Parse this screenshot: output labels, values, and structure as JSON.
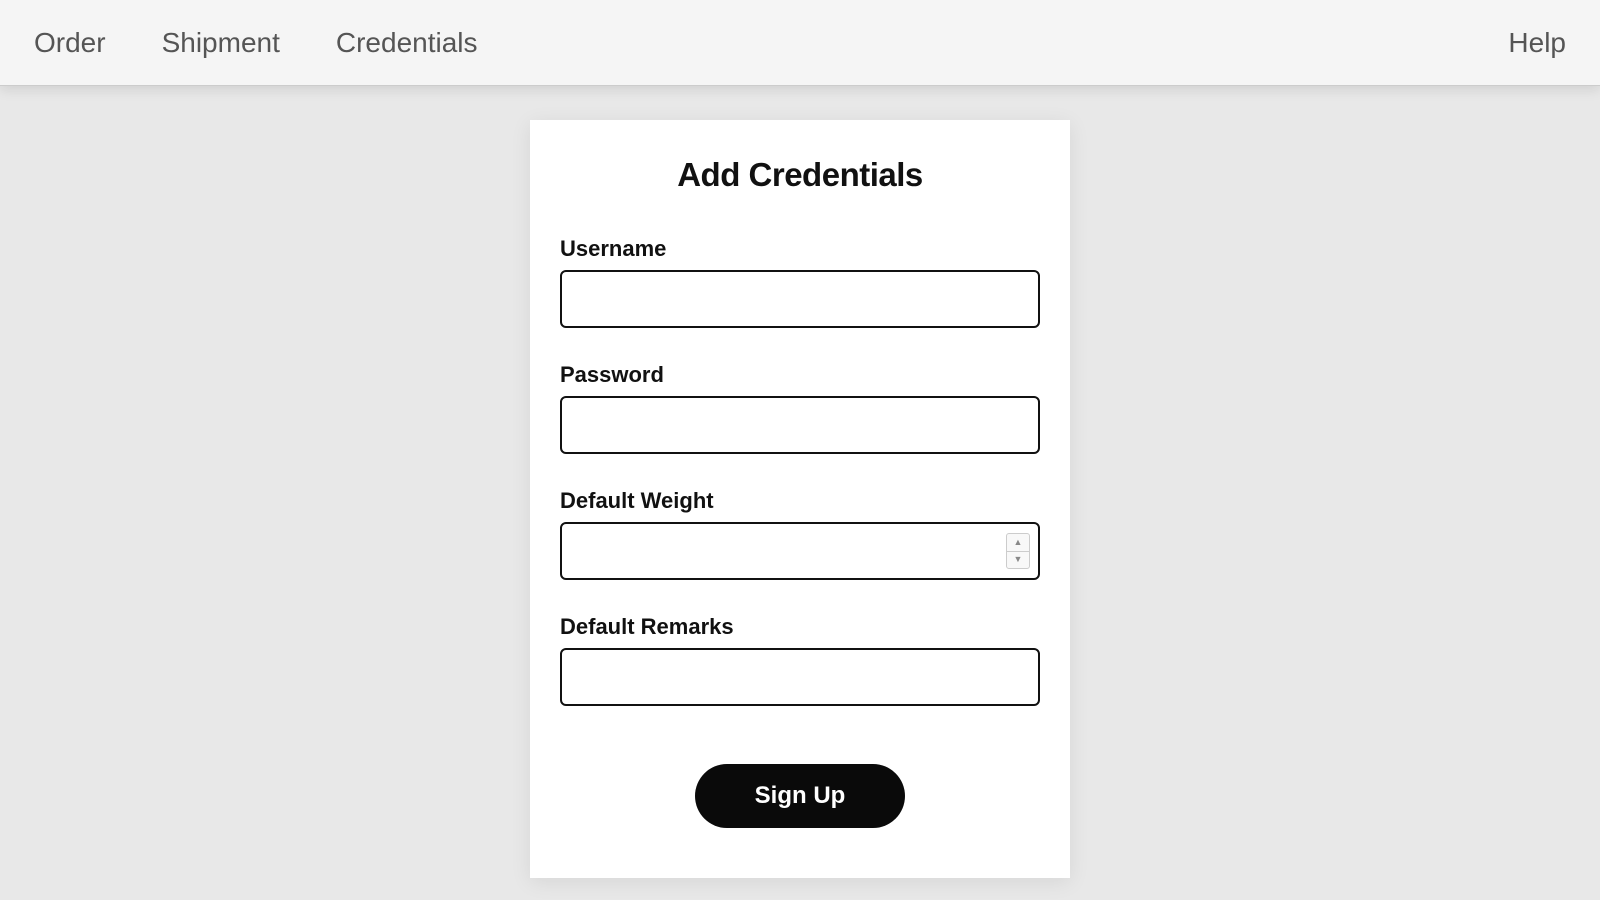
{
  "nav": {
    "items": [
      "Order",
      "Shipment",
      "Credentials"
    ],
    "help": "Help"
  },
  "form": {
    "title": "Add Credentials",
    "fields": {
      "username": {
        "label": "Username",
        "value": ""
      },
      "password": {
        "label": "Password",
        "value": ""
      },
      "defaultWeight": {
        "label": "Default Weight",
        "value": ""
      },
      "defaultRemarks": {
        "label": "Default Remarks",
        "value": ""
      }
    },
    "submit": "Sign Up"
  }
}
